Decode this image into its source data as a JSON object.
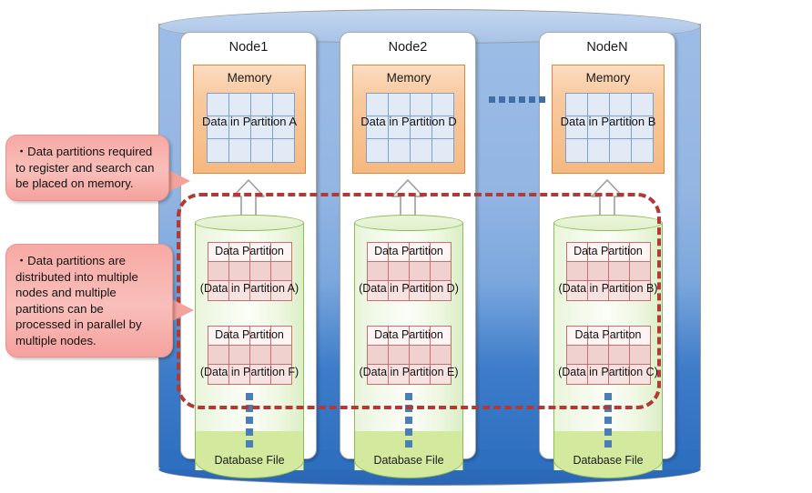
{
  "diagram": {
    "cluster_label": "",
    "inter_node_ellipsis": "......",
    "nodes": [
      {
        "title": "Node1",
        "memory": {
          "title": "Memory",
          "label": "Data in Partition A"
        },
        "db_label": "Database File",
        "partitions": [
          {
            "title": "Data Partition",
            "sub": "(Data in Partition A)"
          },
          {
            "title": "Data Partition",
            "sub": "(Data in Partition F)"
          }
        ],
        "vertical_ellipsis": "⋮"
      },
      {
        "title": "Node2",
        "memory": {
          "title": "Memory",
          "label": "Data in Partition D"
        },
        "db_label": "Database File",
        "partitions": [
          {
            "title": "Data Partition",
            "sub": "(Data in Partition D)"
          },
          {
            "title": "Data Partition",
            "sub": "(Data in Partition E)"
          }
        ],
        "vertical_ellipsis": "⋮"
      },
      {
        "title": "NodeN",
        "memory": {
          "title": "Memory",
          "label": "Data in Partition B"
        },
        "db_label": "Database File",
        "partitions": [
          {
            "title": "Data Partition",
            "sub": "(Data in Partition B)"
          },
          {
            "title": "Data Partiton",
            "sub": "(Data in Partition C)"
          }
        ],
        "vertical_ellipsis": "⋮"
      }
    ],
    "callouts": [
      {
        "text": "・Data partitions required to register and search can be placed on memory."
      },
      {
        "text": "・Data partitions are distributed into multiple nodes and multiple partitions can be processed in parallel by multiple nodes."
      }
    ],
    "colors": {
      "cluster_blue": "#7ba7dd",
      "cluster_blue_dark": "#2f6fc0",
      "memory_orange": "#f6b97f",
      "memory_border": "#e08634",
      "memory_cell": "#e2eaf6",
      "memory_cell_border": "#7ca0cf",
      "db_green": "#d3ea9e",
      "db_green_border": "#8fbc5a",
      "partition_pink": "#efd2d0",
      "partition_border": "#c9706e",
      "dashed_red": "#b03a36",
      "callout_pink": "#f8b3ae",
      "dot_blue": "#4a7fb5"
    }
  }
}
